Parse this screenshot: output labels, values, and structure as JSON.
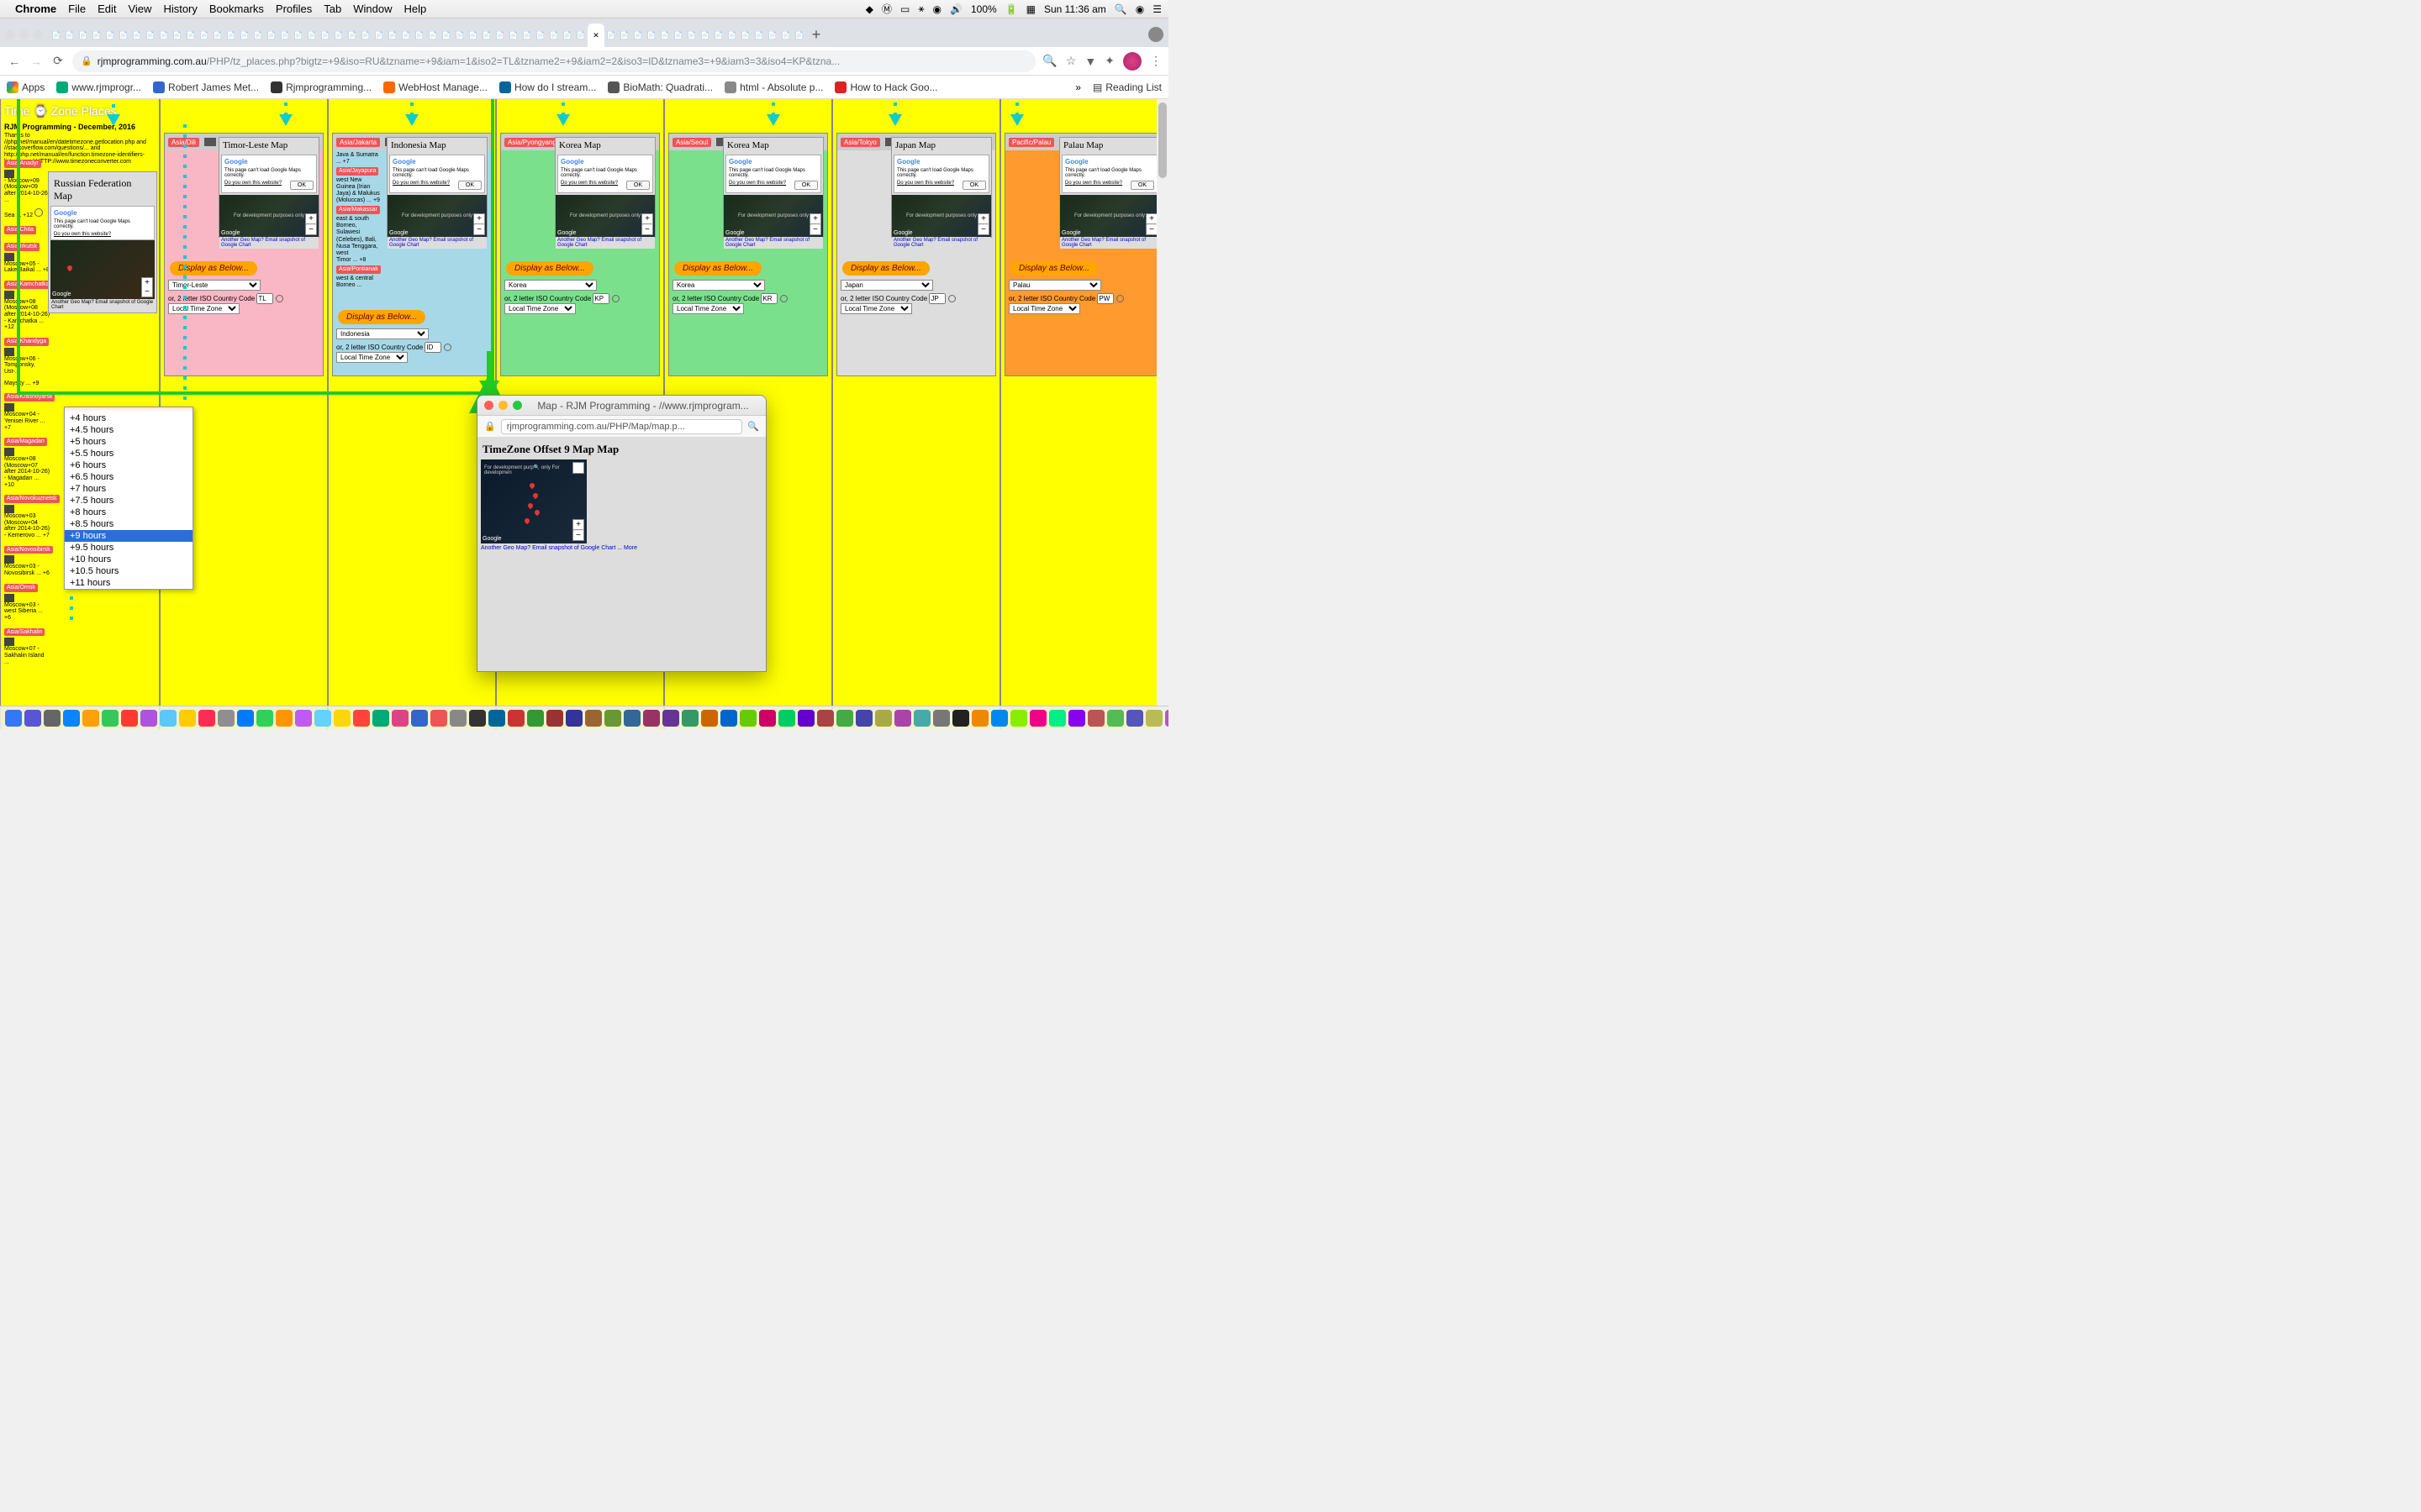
{
  "menubar": {
    "app": "Chrome",
    "items": [
      "File",
      "Edit",
      "View",
      "History",
      "Bookmarks",
      "Profiles",
      "Tab",
      "Window",
      "Help"
    ],
    "battery": "100%",
    "clock": "Sun 11:36 am"
  },
  "addr": {
    "host": "rjmprogramming.com.au",
    "path": "/PHP/tz_places.php?bigtz=+9&iso=RU&tzname=+9&iam=1&iso2=TL&tzname2=+9&iam2=2&iso3=ID&tzname3=+9&iam3=3&iso4=KP&tzna..."
  },
  "bookmarks": [
    {
      "label": "Apps",
      "color": "#ea4335"
    },
    {
      "label": "www.rjmprogr...",
      "color": "#0a7"
    },
    {
      "label": "Robert James Met...",
      "color": "#36c"
    },
    {
      "label": "Rjmprogramming...",
      "color": "#333"
    },
    {
      "label": "WebHost Manage...",
      "color": "#f60"
    },
    {
      "label": "How do I stream...",
      "color": "#069"
    },
    {
      "label": "BioMath: Quadrati...",
      "color": "#555"
    },
    {
      "label": "html - Absolute p...",
      "color": "#888"
    },
    {
      "label": "How to Hack Goo...",
      "color": "#d22"
    }
  ],
  "readingList": "Reading List",
  "page": {
    "title": "Time ⌚ Zone Places",
    "subtitle": "RJM Programming - December, 2016",
    "credits": "Thanks to //php.net/manual/en/datetimezone.getlocation.php and //stackoverflow.com/questions/... and http://php.net/manual/en/function.timezone-identifiers-list.php and HTTP://www.timezoneconverter.com"
  },
  "sidebar_tz": [
    "Asia/Anadyr",
    "Asia/Irkutsk",
    "Asia/Kamchatka",
    "Asia/Khandyga",
    "Asia/Krasnoyarsk",
    "Asia/Magadan",
    "Asia/Novokuznetsk",
    "Asia/Novosibirsk",
    "Asia/Omsk",
    "Asia/Sakhalin"
  ],
  "sidebar_notes": [
    "- Moscow+09 (Moscow+09 after 2014-10-26) ...",
    "Sea ... +12",
    "Moscow+05 - Lake Baikal ... +8",
    "Moscow+08 (Moscow+08 after 2014-10-26) - Kamchatka ... +12",
    "Moscow+06 - Tomponsky, Ust-...",
    "Maysky ... +9",
    "Moscow+04 - Yenisei River ... +7",
    "Moscow+08 (Moscow+07 after 2014-10-26) - Magadan ... +10",
    "Moscow+03 (Moscow+04 after 2014-10-26) - Kemerovo ... +7",
    "Moscow+03 - Novosibirsk ... +6",
    "Moscow+03 - west Siberia ... +6",
    "Moscow+07 - Sakhalin Island ..."
  ],
  "rf_map": {
    "title": "Russian Federation Map"
  },
  "gmap": {
    "logo": "Google",
    "err": "This page can't load Google Maps correctly.",
    "own": "Do you own this website?",
    "ok": "OK",
    "dev": "For development purposes only",
    "links": "Another Geo Map?  Email snapshot of Google Chart"
  },
  "panels": [
    {
      "bg": "#f9b6c4",
      "tz": "Asia/Dili",
      "map": "Timor-Leste Map",
      "country": "Timor-Leste",
      "iso": "TL",
      "tzsel": "Local Time Zone",
      "note": "",
      "dispTop": 152
    },
    {
      "bg": "#a7d8e8",
      "tz": "Asia/Jakarta",
      "map": "Indonesia Map",
      "country": "Indonesia",
      "iso": "ID",
      "tzsel": "Local Time Zone",
      "note": "Java & Sumatra ... +7",
      "extra": [
        "Asia/Jayapura",
        "west New Guinea (Irian Jaya) & Malukus",
        "(Moluccas) ... +9",
        "Asia/Makassar",
        "east & south Borneo, Sulawesi (Celebes), Bali, Nusa Tenggara, west",
        "Timor ... +8",
        "Asia/Pontianak",
        "west & central Borneo ..."
      ],
      "dispTop": 210
    },
    {
      "bg": "#7be08c",
      "tz": "Asia/Pyongyang",
      "map": "Korea Map",
      "country": "Korea",
      "iso": "KP",
      "tzsel": "Local Time Zone",
      "note": "",
      "dispTop": 152
    },
    {
      "bg": "#7be08c",
      "tz": "Asia/Seoul",
      "map": "Korea Map",
      "country": "Korea",
      "iso": "KR",
      "tzsel": "Local Time Zone",
      "note": "",
      "dispTop": 152
    },
    {
      "bg": "#ddd",
      "tz": "Asia/Tokyo",
      "map": "Japan Map",
      "country": "Japan",
      "iso": "JP",
      "tzsel": "Local Time Zone",
      "note": "",
      "dispTop": 152
    },
    {
      "bg": "#ff9a2e",
      "tz": "Pacific/Palau",
      "map": "Palau Map",
      "country": "Palau",
      "iso": "PW",
      "tzsel": "Local Time Zone",
      "note": "",
      "dispTop": 152
    }
  ],
  "display_btn": "Display as Below...",
  "iso_label": "or, 2 letter ISO Country Code",
  "dropdown": {
    "options": [
      "+4 hours",
      "+4.5 hours",
      "+5 hours",
      "+5.5 hours",
      "+6 hours",
      "+6.5 hours",
      "+7 hours",
      "+7.5 hours",
      "+8 hours",
      "+8.5 hours",
      "+9 hours",
      "+9.5 hours",
      "+10 hours",
      "+10.5 hours",
      "+11 hours"
    ],
    "selected": "+9 hours"
  },
  "popup": {
    "title": "Map - RJM Programming - //www.rjmprogram...",
    "url": "rjmprogramming.com.au/PHP/Map/map.p...",
    "heading": "TimeZone Offset 9 Map Map",
    "links": "Another Geo Map?  Email snapshot of Google Chart ... More",
    "dev": "For development purp🔍 only      For developmen"
  }
}
